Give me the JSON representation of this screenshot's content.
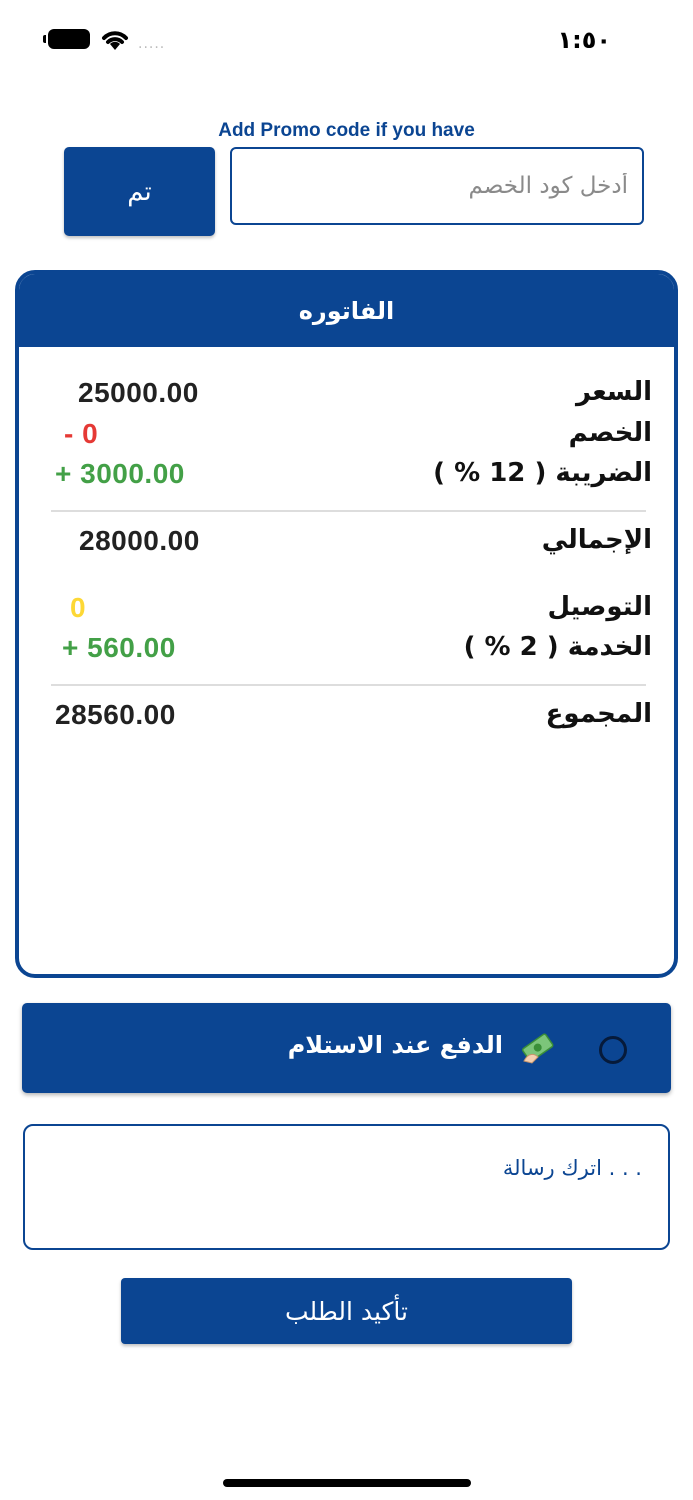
{
  "status_bar": {
    "time": "١:٥٠",
    "signal": "....."
  },
  "promo": {
    "label": "Add Promo code if you have",
    "placeholder": "أدخل كود الخصم",
    "button_label": "تم"
  },
  "invoice": {
    "title": "الفاتوره",
    "rows": [
      {
        "label": "السعر",
        "value": "25000.00",
        "color": "#222222"
      },
      {
        "label": "الخصم",
        "value": "- 0",
        "color": "#e53935"
      },
      {
        "label": "الضريبة ( 12 % )",
        "value": "+ 3000.00",
        "color": "#43a047"
      },
      {
        "label": "الإجمالي",
        "value": "28000.00",
        "color": "#222222"
      },
      {
        "label": "التوصيل",
        "value": "0",
        "color": "#fdd835"
      },
      {
        "label": "الخدمة ( 2 % )",
        "value": "+ 560.00",
        "color": "#43a047"
      },
      {
        "label": "المجموع",
        "value": "28560.00",
        "color": "#222222"
      }
    ]
  },
  "payment": {
    "label": "الدفع عند الاستلام",
    "icon": "money-icon",
    "selected": false
  },
  "message": {
    "placeholder": ". . . اترك رسالة"
  },
  "confirm": {
    "label": "تأكيد الطلب"
  },
  "colors": {
    "primary": "#0b4592",
    "discount": "#e53935",
    "positive": "#43a047",
    "delivery": "#fdd835"
  }
}
